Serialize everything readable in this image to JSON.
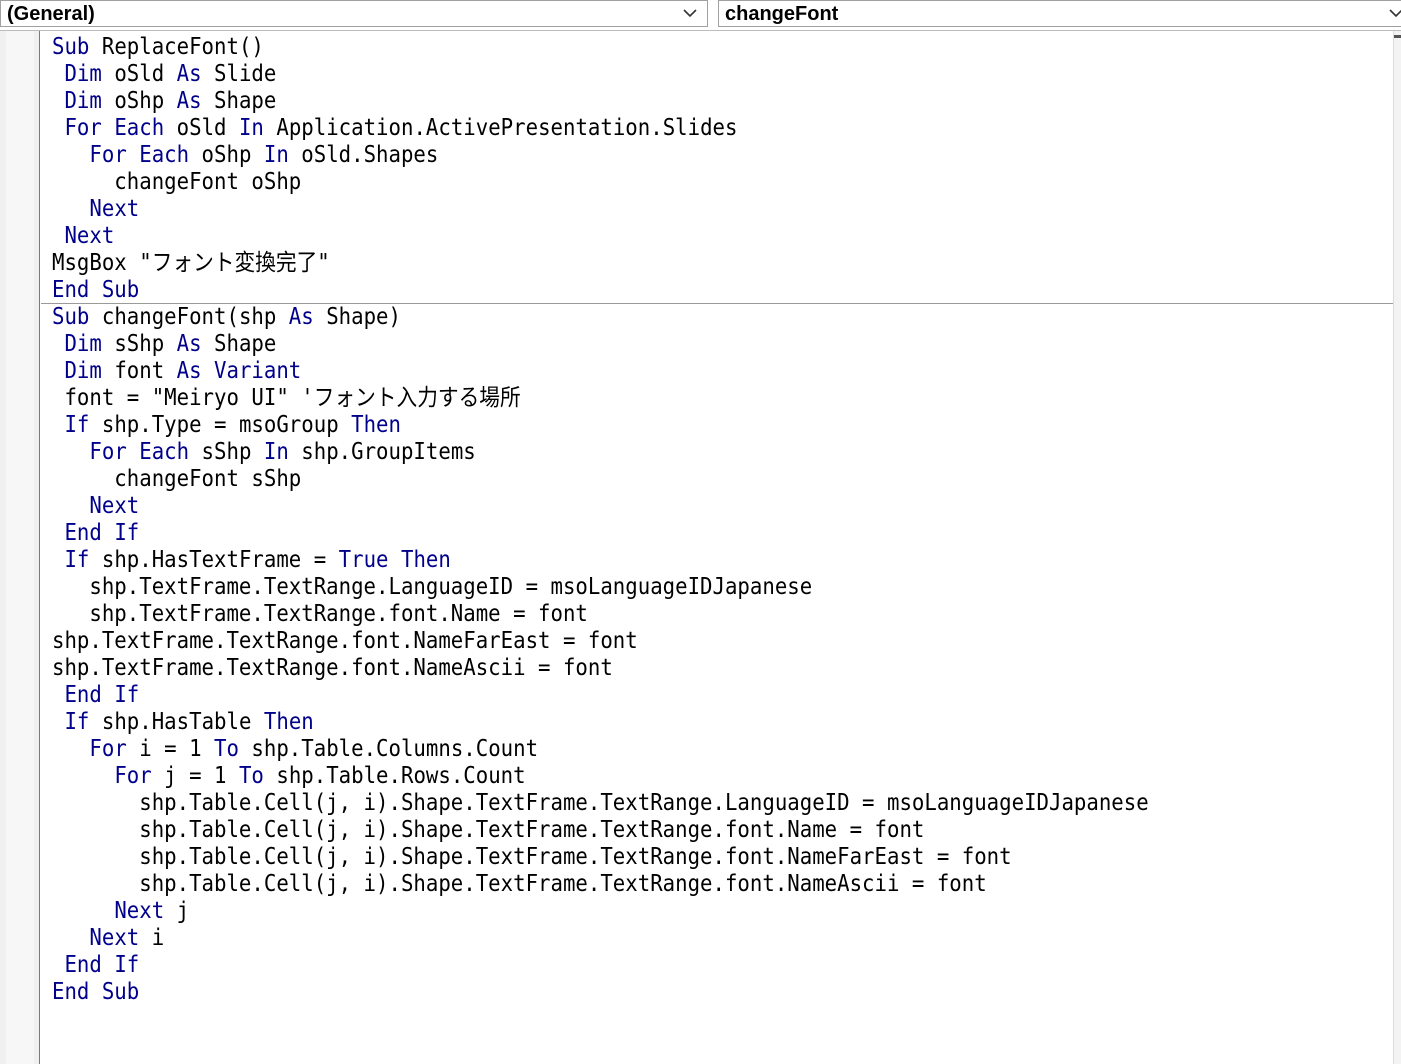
{
  "toolbar": {
    "object_combo": {
      "value": "(General)",
      "arrow_icon": "chevron-down-icon"
    },
    "procedure_combo": {
      "value": "changeFont",
      "arrow_icon": "chevron-down-icon"
    }
  },
  "colors": {
    "keyword": "#00008b",
    "text": "#000000",
    "background": "#ffffff"
  },
  "code": {
    "separator_after_line": 10,
    "lines": [
      [
        {
          "k": 1,
          "t": "Sub"
        },
        {
          "k": 0,
          "t": " ReplaceFont()"
        }
      ],
      [
        {
          "k": 0,
          "t": " "
        },
        {
          "k": 1,
          "t": "Dim"
        },
        {
          "k": 0,
          "t": " oSld "
        },
        {
          "k": 1,
          "t": "As"
        },
        {
          "k": 0,
          "t": " Slide"
        }
      ],
      [
        {
          "k": 0,
          "t": " "
        },
        {
          "k": 1,
          "t": "Dim"
        },
        {
          "k": 0,
          "t": " oShp "
        },
        {
          "k": 1,
          "t": "As"
        },
        {
          "k": 0,
          "t": " Shape"
        }
      ],
      [
        {
          "k": 0,
          "t": " "
        },
        {
          "k": 1,
          "t": "For Each"
        },
        {
          "k": 0,
          "t": " oSld "
        },
        {
          "k": 1,
          "t": "In"
        },
        {
          "k": 0,
          "t": " Application.ActivePresentation.Slides"
        }
      ],
      [
        {
          "k": 0,
          "t": "   "
        },
        {
          "k": 1,
          "t": "For Each"
        },
        {
          "k": 0,
          "t": " oShp "
        },
        {
          "k": 1,
          "t": "In"
        },
        {
          "k": 0,
          "t": " oSld.Shapes"
        }
      ],
      [
        {
          "k": 0,
          "t": "     changeFont oShp"
        }
      ],
      [
        {
          "k": 0,
          "t": "   "
        },
        {
          "k": 1,
          "t": "Next"
        }
      ],
      [
        {
          "k": 0,
          "t": " "
        },
        {
          "k": 1,
          "t": "Next"
        }
      ],
      [
        {
          "k": 0,
          "t": "MsgBox \"フォント変換完了\""
        }
      ],
      [
        {
          "k": 1,
          "t": "End Sub"
        }
      ],
      [
        {
          "k": 1,
          "t": "Sub"
        },
        {
          "k": 0,
          "t": " changeFont(shp "
        },
        {
          "k": 1,
          "t": "As"
        },
        {
          "k": 0,
          "t": " Shape)"
        }
      ],
      [
        {
          "k": 0,
          "t": " "
        },
        {
          "k": 1,
          "t": "Dim"
        },
        {
          "k": 0,
          "t": " sShp "
        },
        {
          "k": 1,
          "t": "As"
        },
        {
          "k": 0,
          "t": " Shape"
        }
      ],
      [
        {
          "k": 0,
          "t": " "
        },
        {
          "k": 1,
          "t": "Dim"
        },
        {
          "k": 0,
          "t": " font "
        },
        {
          "k": 1,
          "t": "As Variant"
        }
      ],
      [
        {
          "k": 0,
          "t": " font = \"Meiryo UI\" 'フォント入力する場所"
        }
      ],
      [
        {
          "k": 0,
          "t": " "
        },
        {
          "k": 1,
          "t": "If"
        },
        {
          "k": 0,
          "t": " shp.Type = msoGroup "
        },
        {
          "k": 1,
          "t": "Then"
        }
      ],
      [
        {
          "k": 0,
          "t": "   "
        },
        {
          "k": 1,
          "t": "For Each"
        },
        {
          "k": 0,
          "t": " sShp "
        },
        {
          "k": 1,
          "t": "In"
        },
        {
          "k": 0,
          "t": " shp.GroupItems"
        }
      ],
      [
        {
          "k": 0,
          "t": "     changeFont sShp"
        }
      ],
      [
        {
          "k": 0,
          "t": "   "
        },
        {
          "k": 1,
          "t": "Next"
        }
      ],
      [
        {
          "k": 0,
          "t": " "
        },
        {
          "k": 1,
          "t": "End If"
        }
      ],
      [
        {
          "k": 0,
          "t": " "
        },
        {
          "k": 1,
          "t": "If"
        },
        {
          "k": 0,
          "t": " shp.HasTextFrame = "
        },
        {
          "k": 1,
          "t": "True Then"
        }
      ],
      [
        {
          "k": 0,
          "t": "   shp.TextFrame.TextRange.LanguageID = msoLanguageIDJapanese"
        }
      ],
      [
        {
          "k": 0,
          "t": "   shp.TextFrame.TextRange.font.Name = font"
        }
      ],
      [
        {
          "k": 0,
          "t": "shp.TextFrame.TextRange.font.NameFarEast = font"
        }
      ],
      [
        {
          "k": 0,
          "t": "shp.TextFrame.TextRange.font.NameAscii = font"
        }
      ],
      [
        {
          "k": 0,
          "t": " "
        },
        {
          "k": 1,
          "t": "End If"
        }
      ],
      [
        {
          "k": 0,
          "t": " "
        },
        {
          "k": 1,
          "t": "If"
        },
        {
          "k": 0,
          "t": " shp.HasTable "
        },
        {
          "k": 1,
          "t": "Then"
        }
      ],
      [
        {
          "k": 0,
          "t": "   "
        },
        {
          "k": 1,
          "t": "For"
        },
        {
          "k": 0,
          "t": " i = 1 "
        },
        {
          "k": 1,
          "t": "To"
        },
        {
          "k": 0,
          "t": " shp.Table.Columns.Count"
        }
      ],
      [
        {
          "k": 0,
          "t": "     "
        },
        {
          "k": 1,
          "t": "For"
        },
        {
          "k": 0,
          "t": " j = 1 "
        },
        {
          "k": 1,
          "t": "To"
        },
        {
          "k": 0,
          "t": " shp.Table.Rows.Count"
        }
      ],
      [
        {
          "k": 0,
          "t": "       shp.Table.Cell(j, i).Shape.TextFrame.TextRange.LanguageID = msoLanguageIDJapanese"
        }
      ],
      [
        {
          "k": 0,
          "t": "       shp.Table.Cell(j, i).Shape.TextFrame.TextRange.font.Name = font"
        }
      ],
      [
        {
          "k": 0,
          "t": "       shp.Table.Cell(j, i).Shape.TextFrame.TextRange.font.NameFarEast = font"
        }
      ],
      [
        {
          "k": 0,
          "t": "       shp.Table.Cell(j, i).Shape.TextFrame.TextRange.font.NameAscii = font"
        }
      ],
      [
        {
          "k": 0,
          "t": "     "
        },
        {
          "k": 1,
          "t": "Next"
        },
        {
          "k": 0,
          "t": " j"
        }
      ],
      [
        {
          "k": 0,
          "t": "   "
        },
        {
          "k": 1,
          "t": "Next"
        },
        {
          "k": 0,
          "t": " i"
        }
      ],
      [
        {
          "k": 0,
          "t": " "
        },
        {
          "k": 1,
          "t": "End If"
        }
      ],
      [
        {
          "k": 1,
          "t": "End Sub"
        }
      ]
    ]
  }
}
